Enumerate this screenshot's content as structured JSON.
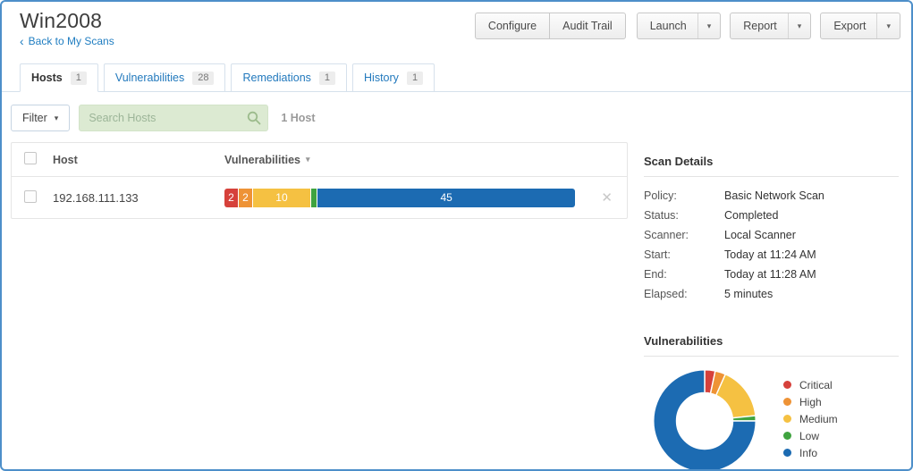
{
  "icons": {
    "caret_down": "▾",
    "close": "✕",
    "back": "‹"
  },
  "header": {
    "title": "Win2008",
    "back_label": "Back to My Scans",
    "buttons": {
      "configure": "Configure",
      "audit_trail": "Audit Trail",
      "launch": "Launch",
      "report": "Report",
      "export": "Export"
    }
  },
  "tabs": [
    {
      "label": "Hosts",
      "badge": "1",
      "active": true
    },
    {
      "label": "Vulnerabilities",
      "badge": "28",
      "active": false
    },
    {
      "label": "Remediations",
      "badge": "1",
      "active": false
    },
    {
      "label": "History",
      "badge": "1",
      "active": false
    }
  ],
  "filter_bar": {
    "filter_label": "Filter",
    "search_placeholder": "Search Hosts",
    "host_count": "1 Host"
  },
  "table": {
    "columns": [
      "Host",
      "Vulnerabilities"
    ],
    "rows": [
      {
        "host": "192.168.111.133",
        "severities": [
          {
            "label": "Critical",
            "value": 2,
            "color": "#d6413b"
          },
          {
            "label": "High",
            "value": 2,
            "color": "#ee9336"
          },
          {
            "label": "Medium",
            "value": 10,
            "color": "#f5c142"
          },
          {
            "label": "Low",
            "value": 1,
            "color": "#3fa33f"
          },
          {
            "label": "Info",
            "value": 45,
            "color": "#1c6bb2"
          }
        ]
      }
    ]
  },
  "scan_details": {
    "heading": "Scan Details",
    "fields": [
      {
        "label": "Policy:",
        "value": "Basic Network Scan"
      },
      {
        "label": "Status:",
        "value": "Completed"
      },
      {
        "label": "Scanner:",
        "value": "Local Scanner"
      },
      {
        "label": "Start:",
        "value": "Today at 11:24 AM"
      },
      {
        "label": "End:",
        "value": "Today at 11:28 AM"
      },
      {
        "label": "Elapsed:",
        "value": "5 minutes"
      }
    ]
  },
  "chart_data": {
    "type": "pie",
    "donut": true,
    "title": "Vulnerabilities",
    "categories": [
      "Critical",
      "High",
      "Medium",
      "Low",
      "Info"
    ],
    "values": [
      2,
      2,
      10,
      1,
      45
    ],
    "colors": [
      "#d6413b",
      "#ee9336",
      "#f5c142",
      "#3fa33f",
      "#1c6bb2"
    ],
    "legend_position": "right"
  }
}
